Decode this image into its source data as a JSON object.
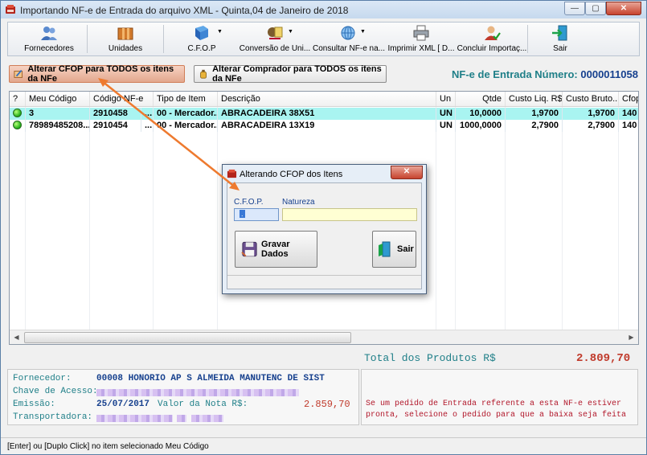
{
  "window": {
    "title": "Importando NF-e de Entrada do arquivo XML - Quinta,04 de Janeiro de 2018",
    "controls": [
      "minimize",
      "maximize",
      "close"
    ]
  },
  "toolbar": {
    "items": [
      {
        "label": "Fornecedores",
        "icon": "users-icon"
      },
      {
        "label": "Unidades",
        "icon": "boxes-icon"
      },
      {
        "label": "C.F.O.P",
        "icon": "book-icon"
      },
      {
        "label": "Conversão de Uni...",
        "icon": "conversion-icon"
      },
      {
        "label": "Consultar NF-e na...",
        "icon": "globe-icon"
      },
      {
        "label": "Imprimir XML [ D...",
        "icon": "printer-icon"
      },
      {
        "label": "Concluir Importaç...",
        "icon": "user-check-icon"
      },
      {
        "label": "Sair",
        "icon": "exit-door-icon"
      }
    ]
  },
  "actions": {
    "alterar_cfop": "Alterar CFOP para TODOS os itens da NFe",
    "alterar_comprador": "Alterar Comprador para TODOS os itens da NFe"
  },
  "nfe": {
    "label": "NF-e de Entrada Número:",
    "number": "0000011058"
  },
  "grid": {
    "columns": [
      "?",
      "Meu Código",
      "Código NF-e",
      "Tipo de Item",
      "Descrição",
      "Un",
      "Qtde",
      "Custo Liq. R$",
      "Custo Bruto...",
      "Cfop"
    ],
    "rows": [
      {
        "status": "green",
        "meu_codigo": "3",
        "codigo_nfe": "2910458",
        "extra": "...",
        "tipo": "00 - Mercador...",
        "descricao": "ABRACADEIRA 38X51",
        "un": "UN",
        "qtde": "10,0000",
        "custo_liq": "1,9700",
        "custo_bruto": "1,9700",
        "cfop": "140",
        "selected": true
      },
      {
        "status": "green",
        "meu_codigo": "78989485208...",
        "codigo_nfe": "2910454",
        "extra": "...",
        "tipo": "00 - Mercador...",
        "descricao": "ABRACADEIRA 13X19",
        "un": "UN",
        "qtde": "1000,0000",
        "custo_liq": "2,7900",
        "custo_bruto": "2,7900",
        "cfop": "140",
        "selected": false
      }
    ]
  },
  "totals": {
    "label": "Total dos Produtos R$",
    "value": "2.809,70"
  },
  "info": {
    "fornecedor_label": "Fornecedor:",
    "fornecedor_value": "00008 HONORIO AP S ALMEIDA MANUTENC DE SIST",
    "chave_label": "Chave de Acesso:",
    "emissao_label": "Emissão:",
    "emissao_value": "25/07/2017",
    "valor_label": "Valor da Nota R$:",
    "valor_value": "2.859,70",
    "transportadora_label": "Transportadora:",
    "message_line1": "Se um pedido de Entrada referente a esta NF-e estiver",
    "message_line2": "pronta, selecione o pedido para que a baixa seja feita"
  },
  "status_bar": {
    "text": "[Enter] ou [Duplo Click] no item selecionado Meu Código"
  },
  "dialog": {
    "title": "Alterando CFOP dos Itens",
    "cfop_label": "C.F.O.P.",
    "cfop_value": ".",
    "natureza_label": "Natureza",
    "natureza_value": "",
    "save_label": "Gravar Dados",
    "exit_label": "Sair"
  },
  "colors": {
    "accent_teal": "#1f7f88",
    "accent_blue": "#16408e",
    "value_red": "#c03a2b",
    "selected_row": "#a9f4f1",
    "annotation_arrow": "#ee7a2f"
  }
}
